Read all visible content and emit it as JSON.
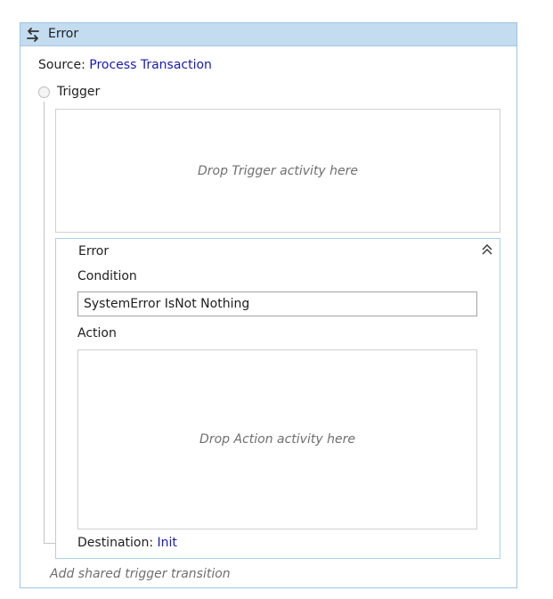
{
  "header": {
    "title": "Error",
    "icon": "swap-arrows-icon"
  },
  "source": {
    "label": "Source:",
    "value": "Process Transaction"
  },
  "trigger": {
    "label": "Trigger",
    "drop_placeholder": "Drop Trigger activity here"
  },
  "transition": {
    "title": "Error",
    "collapse_icon": "double-chevron-up-icon",
    "condition_label": "Condition",
    "condition_value": "SystemError IsNot Nothing",
    "action_label": "Action",
    "action_placeholder": "Drop Action activity here",
    "destination_label": "Destination:",
    "destination_value": "Init"
  },
  "footer": {
    "add_shared": "Add shared trigger transition"
  },
  "colors": {
    "header_bg": "#c3dcf0",
    "panel_border": "#9ec4e2",
    "link": "#1a1ab4",
    "placeholder": "#6f6f6f"
  }
}
